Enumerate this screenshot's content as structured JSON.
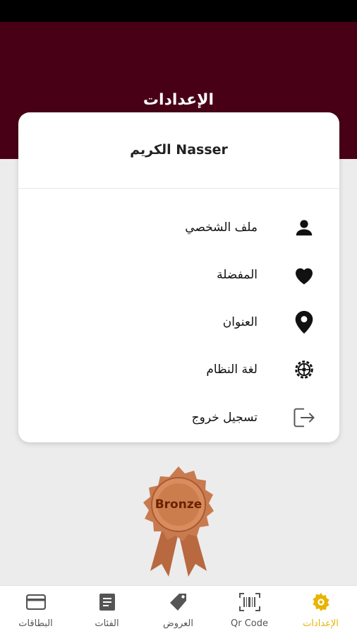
{
  "header": {
    "title": "الإعدادات"
  },
  "profile": {
    "name": "الكريم Nasser"
  },
  "menu": [
    {
      "label": "ملف الشخصي",
      "icon": "person-icon"
    },
    {
      "label": "المفضلة",
      "icon": "heart-icon"
    },
    {
      "label": "العنوان",
      "icon": "location-pin-icon"
    },
    {
      "label": "لغة النظام",
      "icon": "gear-icon"
    },
    {
      "label": "تسجيل خروج",
      "icon": "logout-icon"
    }
  ],
  "badge": {
    "tier": "Bronze"
  },
  "nav": [
    {
      "label": "البطاقات",
      "icon": "credit-card-icon"
    },
    {
      "label": "الفئات",
      "icon": "list-icon"
    },
    {
      "label": "العروض",
      "icon": "tag-icon"
    },
    {
      "label": "Qr Code",
      "icon": "barcode-icon"
    },
    {
      "label": "الإعدادات",
      "icon": "settings-icon"
    }
  ],
  "colors": {
    "header": "#480016",
    "active": "#e7b400",
    "badge": "#c97a4e"
  }
}
